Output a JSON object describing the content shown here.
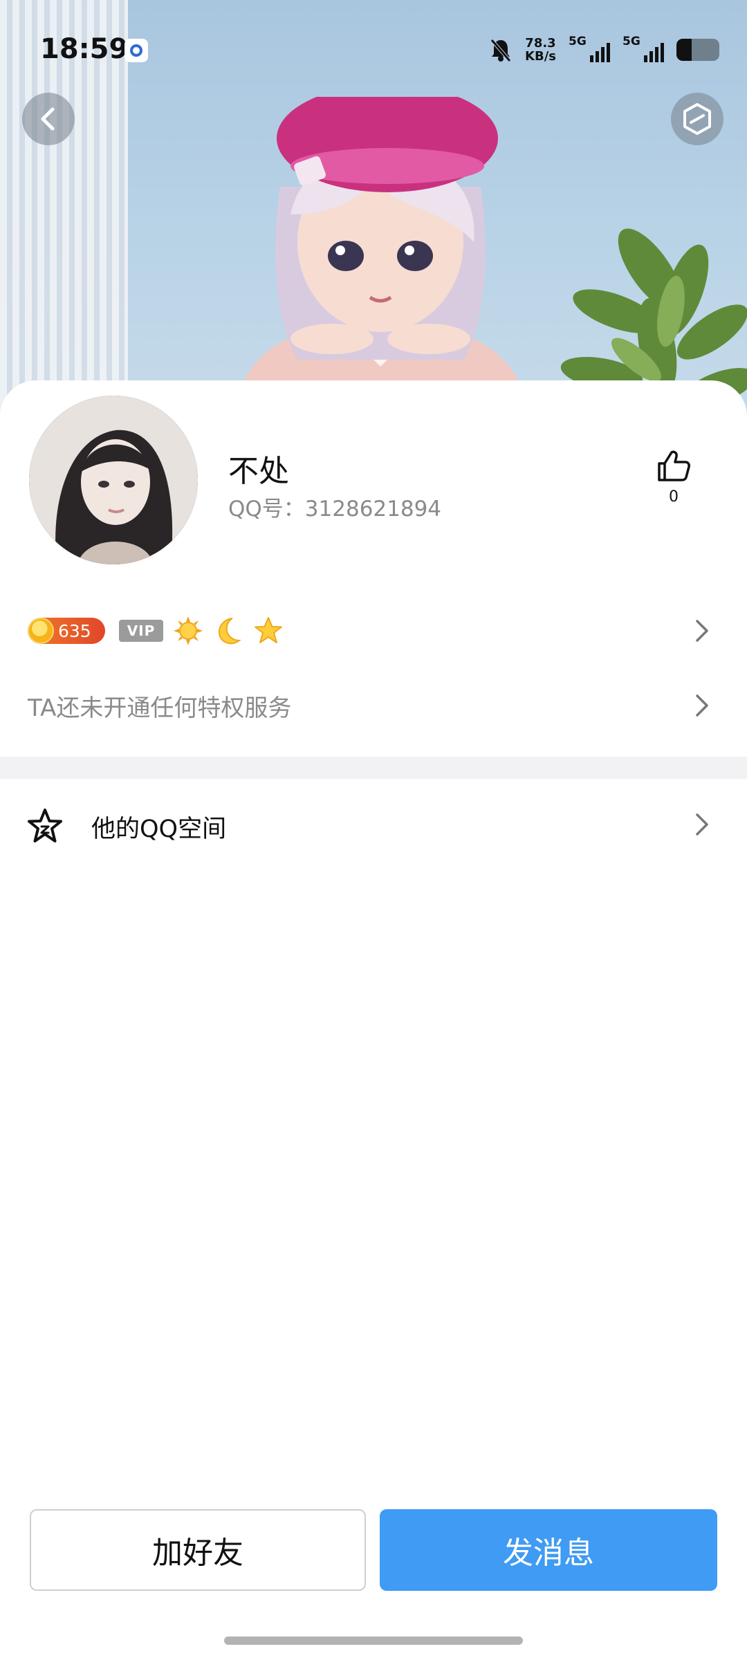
{
  "status_bar": {
    "time": "18:59",
    "speed_value": "78.3",
    "speed_unit": "KB/s",
    "network_1": "5G",
    "network_2": "5G",
    "battery_percent": 35
  },
  "header": {
    "back_icon": "chevron-left-icon",
    "settings_icon": "hexagon-slash-icon"
  },
  "profile": {
    "name": "不处",
    "qq_label": "QQ号：3128621894",
    "like_icon": "thumbs-up-icon",
    "like_count": "0"
  },
  "badges": {
    "level": "635",
    "vip": "VIP",
    "icons": [
      "sun-icon",
      "moon-icon",
      "star-icon"
    ]
  },
  "privilege": {
    "text": "TA还未开通任何特权服务"
  },
  "qzone": {
    "label": "他的QQ空间",
    "icon": "qzone-star-icon"
  },
  "actions": {
    "add_friend": "加好友",
    "send_message": "发消息"
  },
  "colors": {
    "primary": "#3f9bf3",
    "secondary_text": "#8a8a8a",
    "divider": "#f2f2f4"
  }
}
